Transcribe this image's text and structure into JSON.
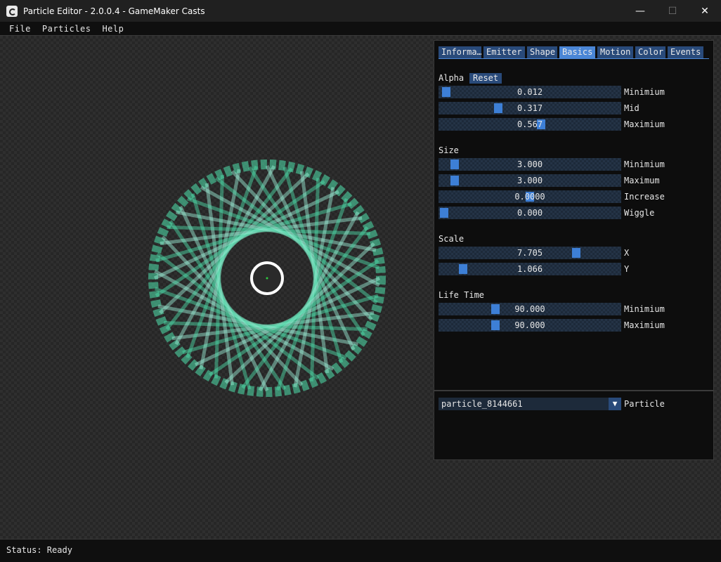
{
  "window": {
    "title": "Particle Editor - 2.0.0.4 - GameMaker Casts",
    "minimize": "—",
    "maximize": "☐",
    "close": "✕"
  },
  "menu": [
    "File",
    "Particles",
    "Help"
  ],
  "tabs": [
    {
      "label": "Informa…",
      "active": false
    },
    {
      "label": "Emitter",
      "active": false
    },
    {
      "label": "Shape",
      "active": false
    },
    {
      "label": "Basics",
      "active": true
    },
    {
      "label": "Motion",
      "active": false
    },
    {
      "label": "Color",
      "active": false
    },
    {
      "label": "Events",
      "active": false
    }
  ],
  "alpha": {
    "label": "Alpha",
    "reset": "Reset",
    "sliders": [
      {
        "value": "0.012",
        "label": "Minimium",
        "fraction": 0.012
      },
      {
        "value": "0.317",
        "label": "Mid",
        "fraction": 0.317
      },
      {
        "value": "0.567",
        "label": "Maximium",
        "fraction": 0.567
      }
    ]
  },
  "size": {
    "label": "Size",
    "sliders": [
      {
        "value": "3.000",
        "label": "Minimium",
        "fraction": 0.06
      },
      {
        "value": "3.000",
        "label": "Maximum",
        "fraction": 0.06
      },
      {
        "value": "0.0000",
        "label": "Increase",
        "fraction": 0.5
      },
      {
        "value": "0.000",
        "label": "Wiggle",
        "fraction": 0.0
      }
    ]
  },
  "scale": {
    "label": "Scale",
    "sliders": [
      {
        "value": "7.705",
        "label": "X",
        "fraction": 0.77
      },
      {
        "value": "1.066",
        "label": "Y",
        "fraction": 0.11
      }
    ]
  },
  "lifetime": {
    "label": "Life Time",
    "sliders": [
      {
        "value": "90.000",
        "label": "Minimium",
        "fraction": 0.3
      },
      {
        "value": "90.000",
        "label": "Maximium",
        "fraction": 0.3
      }
    ]
  },
  "particle_select": {
    "value": "particle_8144661",
    "arrow": "▼",
    "label": "Particle"
  },
  "status": "Status: Ready",
  "colors": {
    "particle": "#4ee2ad",
    "particle_light": "#9ff5dc",
    "accent": "#3d7fd6",
    "tab": "#294a7a"
  }
}
